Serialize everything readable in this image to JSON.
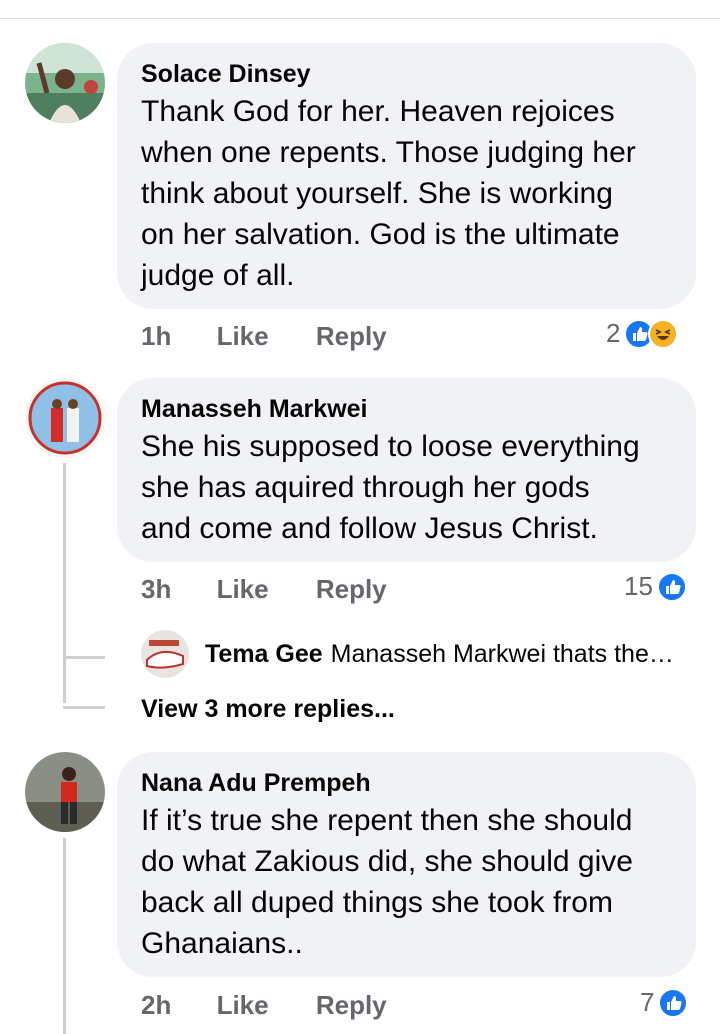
{
  "comments": [
    {
      "author": "Solace Dinsey",
      "text": "Thank God for her. Heaven rejoices when one repents. Those judging her think about yourself. She is working on her salvation. God is the ultimate judge of all.",
      "lines": [
        "Thank God for her. Heaven rejoices",
        "when one repents. Those judging her",
        "think about yourself. She is working",
        "on her salvation. God is the ultimate",
        "judge of all."
      ],
      "time": "1h",
      "like_label": "Like",
      "reply_label": "Reply",
      "reaction_count": "2",
      "reactions": [
        "like-icon",
        "haha-icon"
      ]
    },
    {
      "author": "Manasseh Markwei",
      "lines": [
        "She his supposed to loose everything",
        "she has aquired through her gods",
        "and come and follow Jesus Christ."
      ],
      "time": "3h",
      "like_label": "Like",
      "reply_label": "Reply",
      "reaction_count": "15",
      "reactions": [
        "like-icon"
      ],
      "reply_preview": {
        "author": "Tema Gee",
        "text": "Manasseh Markwei thats the…"
      },
      "more_replies": "View 3 more replies..."
    },
    {
      "author": "Nana Adu Prempeh",
      "lines": [
        "If it’s true she repent then she should",
        "do what Zakious did, she should give",
        "back all duped things she took from",
        "Ghanaians.."
      ],
      "time": "2h",
      "like_label": "Like",
      "reply_label": "Reply",
      "reaction_count": "7",
      "reactions": [
        "like-icon"
      ]
    }
  ],
  "colors": {
    "bubble": "#f0f2f5",
    "meta_text": "#65676b",
    "like_blue": "#1877f2",
    "haha_yellow": "#f7b125"
  }
}
